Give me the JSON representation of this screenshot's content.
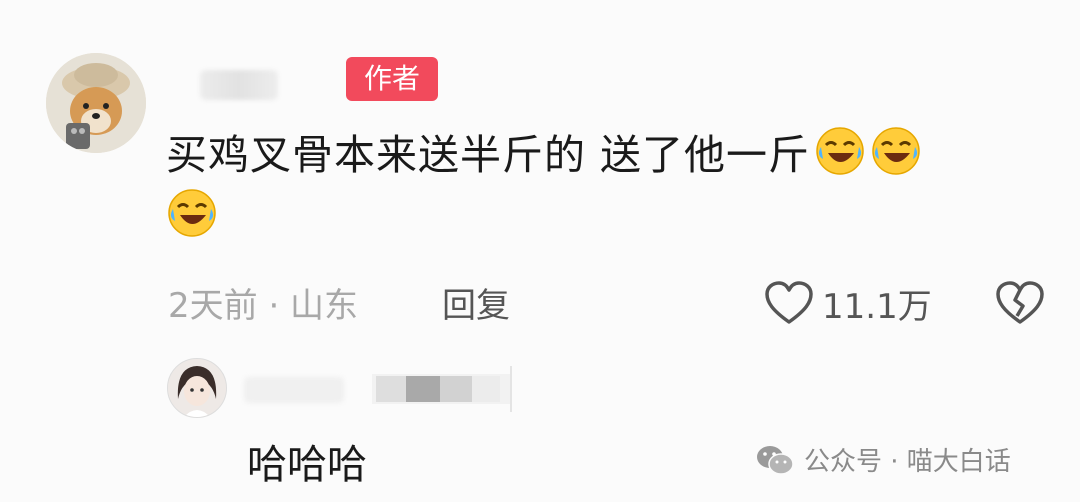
{
  "comment": {
    "author_badge": "作者",
    "text_line1": "买鸡叉骨本来送半斤的 送了他一斤",
    "meta": "2天前 · 山东",
    "reply_label": "回复",
    "like_count": "11.1万",
    "icons": [
      "laughing-crying-emoji",
      "heart-outline-icon",
      "broken-heart-icon"
    ]
  },
  "reply": {
    "text": "哈哈哈"
  },
  "watermark": {
    "text": "公众号 · 喵大白话",
    "icon": "wechat-icon"
  }
}
